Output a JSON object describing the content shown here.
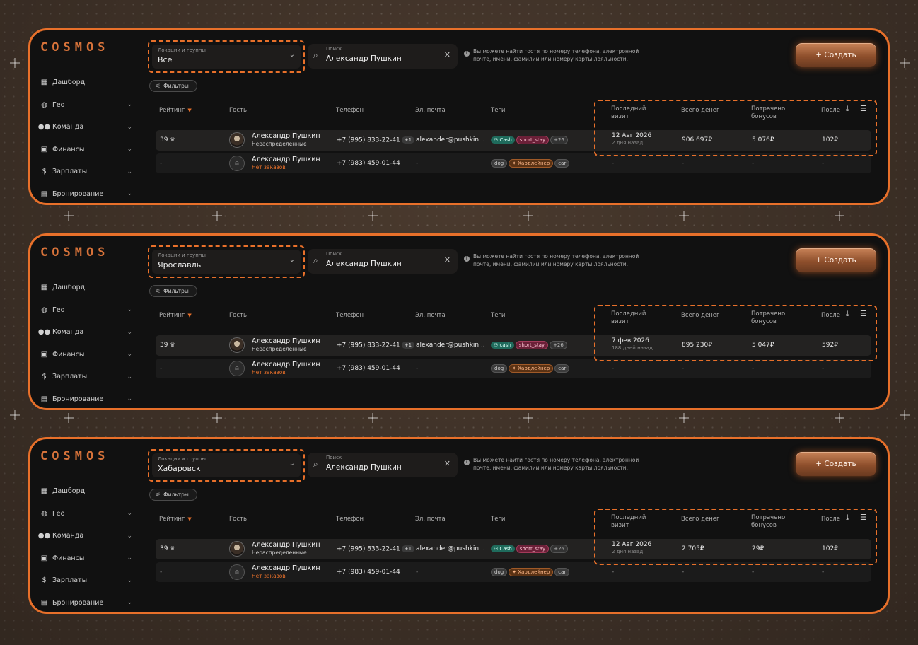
{
  "brand": "COSMOS",
  "sidebar_items": [
    {
      "label": "Дашборд",
      "icon": "dashboard-icon",
      "has_chevron": false
    },
    {
      "label": "Гео",
      "icon": "globe-icon",
      "has_chevron": true
    },
    {
      "label": "Команда",
      "icon": "team-icon",
      "has_chevron": true
    },
    {
      "label": "Финансы",
      "icon": "wallet-icon",
      "has_chevron": true
    },
    {
      "label": "Зарплаты",
      "icon": "salary-icon",
      "has_chevron": true
    },
    {
      "label": "Бронирование",
      "icon": "calendar-icon",
      "has_chevron": true
    }
  ],
  "toolbar": {
    "location_label": "Локации и группы",
    "search_label": "Поиск",
    "search_value": "Александр Пушкин",
    "hint": "Вы можете найти гостя по номеру телефона, электронной почте, имени, фамилии или номеру карты лояльности.",
    "create_label": "+ Создать",
    "filters_label": "Фильтры"
  },
  "columns": {
    "rating": "Рейтинг",
    "guest": "Гость",
    "phone": "Телефон",
    "email": "Эл. почта",
    "tags": "Теги",
    "last_visit_1": "Последний",
    "last_visit_2": "визит",
    "total_money": "Всего денег",
    "spent_bonus_1": "Потрачено",
    "spent_bonus_2": "бонусов",
    "last_col": "После"
  },
  "panels": [
    {
      "location": "Все",
      "row1": {
        "rating": "39",
        "name": "Александр Пушкин",
        "sub": "Нераспределенные",
        "phone": "+7 (995) 833-22-41",
        "phone_extra": "+1",
        "email": "alexander@pushkin...",
        "tag1": "Cash",
        "tag2": "short_stay",
        "tag_more": "+26",
        "visit": "12 Авг 2026",
        "visit_ago": "2 дня назад",
        "money": "906 697₽",
        "bonus": "5 076₽",
        "last": "102₽"
      },
      "row2": {
        "rating": "-",
        "name": "Александр Пушкин",
        "sub": "Нет заказов",
        "phone": "+7 (983) 459-01-44",
        "email": "-",
        "tag1": "dog",
        "tag2": "Хардлейнер",
        "tag3": "car",
        "visit": "-",
        "money": "-",
        "bonus": "-",
        "last": "-"
      }
    },
    {
      "location": "Ярославль",
      "row1": {
        "rating": "39",
        "name": "Александр Пушкин",
        "sub": "Нераспределенные",
        "phone": "+7 (995) 833-22-41",
        "phone_extra": "+1",
        "email": "alexander@pushkin...",
        "tag1": "cash",
        "tag2": "short_stay",
        "tag_more": "+26",
        "visit": "7 фев 2026",
        "visit_ago": "188 дней назад",
        "money": "895 230₽",
        "bonus": "5 047₽",
        "last": "592₽"
      },
      "row2": {
        "rating": "-",
        "name": "Александр Пушкин",
        "sub": "Нет заказов",
        "phone": "+7 (983) 459-01-44",
        "email": "-",
        "tag1": "dog",
        "tag2": "Хардлейнер",
        "tag3": "car",
        "visit": "-",
        "money": "-",
        "bonus": "-",
        "last": "-"
      }
    },
    {
      "location": "Хабаровск",
      "row1": {
        "rating": "39",
        "name": "Александр Пушкин",
        "sub": "Нераспределенные",
        "phone": "+7 (995) 833-22-41",
        "phone_extra": "+1",
        "email": "alexander@pushkin...",
        "tag1": "Cash",
        "tag2": "short_stay",
        "tag_more": "+26",
        "visit": "12 Авг 2026",
        "visit_ago": "2 дня назад",
        "money": "2 705₽",
        "bonus": "29₽",
        "last": "102₽"
      },
      "row2": {
        "rating": "-",
        "name": "Александр Пушкин",
        "sub": "Нет заказов",
        "phone": "+7 (983) 459-01-44",
        "email": "-",
        "tag1": "dog",
        "tag2": "Хардлейнер",
        "tag3": "car",
        "visit": "-",
        "money": "-",
        "bonus": "-",
        "last": "-"
      }
    }
  ]
}
